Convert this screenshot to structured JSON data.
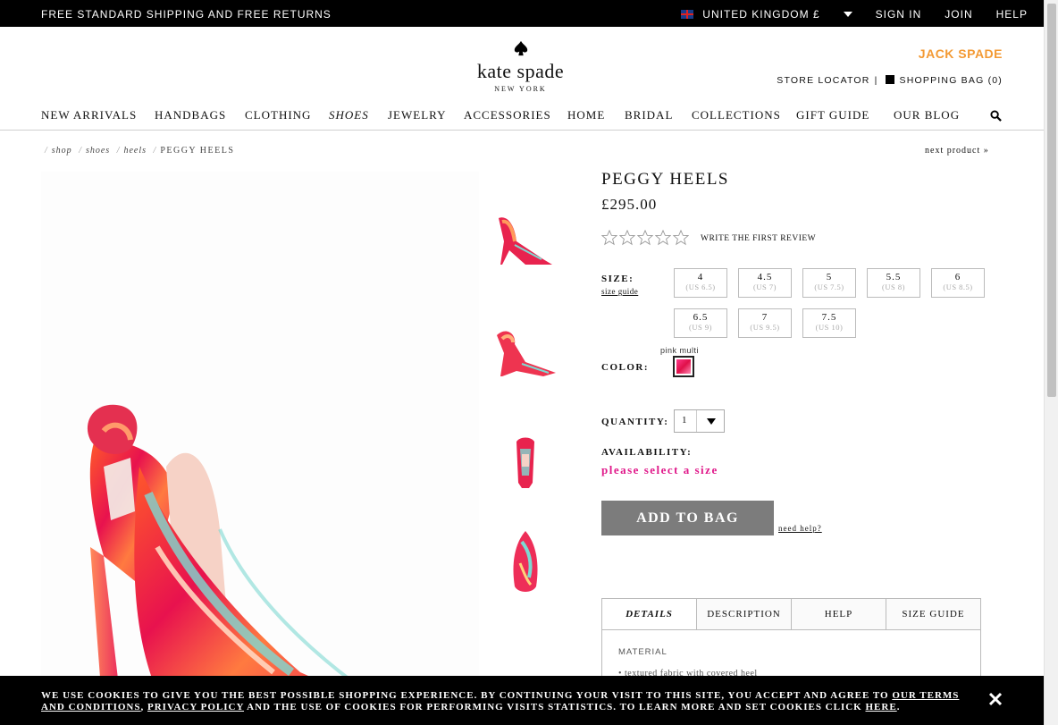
{
  "topbar": {
    "shipping": "FREE STANDARD SHIPPING AND FREE RETURNS",
    "country": "UNITED KINGDOM £",
    "sign_in": "SIGN IN",
    "join": "JOIN",
    "help": "HELP"
  },
  "header": {
    "brand": "kate spade",
    "brand_sub": "NEW YORK",
    "jack_spade": "JACK SPADE",
    "store_locator": "STORE LOCATOR",
    "separator": "|",
    "shopping_bag": "SHOPPING BAG (0)"
  },
  "nav": {
    "items": [
      "NEW ARRIVALS",
      "HANDBAGS",
      "CLOTHING",
      "SHOES",
      "JEWELRY",
      "ACCESSORIES",
      "HOME",
      "BRIDAL",
      "COLLECTIONS",
      "GIFT GUIDE",
      "OUR BLOG"
    ],
    "active": "SHOES"
  },
  "breadcrumb": {
    "items": [
      "shop",
      "shoes",
      "heels"
    ],
    "current": "PEGGY HEELS",
    "next": "next product »"
  },
  "product": {
    "title": "PEGGY HEELS",
    "price": "£295.00",
    "rating": 0,
    "rating_max": 5,
    "review_link": "WRITE THE FIRST REVIEW",
    "size_label": "SIZE:",
    "size_guide": "size guide",
    "sizes": [
      {
        "uk": "4",
        "us": "(US 6.5)"
      },
      {
        "uk": "4.5",
        "us": "(US 7)"
      },
      {
        "uk": "5",
        "us": "(US 7.5)"
      },
      {
        "uk": "5.5",
        "us": "(US 8)"
      },
      {
        "uk": "6",
        "us": "(US 8.5)"
      },
      {
        "uk": "6.5",
        "us": "(US 9)"
      },
      {
        "uk": "7",
        "us": "(US 9.5)"
      },
      {
        "uk": "7.5",
        "us": "(US 10)"
      }
    ],
    "color_label": "COLOR:",
    "color_name": "pink multi",
    "quantity_label": "QUANTITY:",
    "quantity": "1",
    "availability_label": "AVAILABILITY:",
    "availability_msg": "please select a size",
    "add_to_bag": "ADD TO BAG",
    "need_help": "need help?"
  },
  "tabs": {
    "items": [
      "DETAILS",
      "DESCRIPTION",
      "HELP",
      "SIZE GUIDE"
    ],
    "material_heading": "MATERIAL",
    "material_item": "textured fabric with covered heel"
  },
  "cookie": {
    "text_1": "WE USE COOKIES TO GIVE YOU THE BEST POSSIBLE SHOPPING EXPERIENCE. BY CONTINUING YOUR VISIT TO THIS SITE, YOU ACCEPT AND AGREE TO ",
    "terms": "OUR TERMS AND CONDITIONS",
    "sep": ", ",
    "privacy": "PRIVACY POLICY",
    "text_2": " AND THE USE OF COOKIES FOR PERFORMING VISITS STATISTICS. TO LEARN MORE AND SET COOKIES CLICK ",
    "here": "HERE",
    "end": "."
  },
  "colors": {
    "accent_pink": "#e0198a",
    "jack_orange": "#f39a34",
    "button_gray": "#7c7c7c"
  }
}
